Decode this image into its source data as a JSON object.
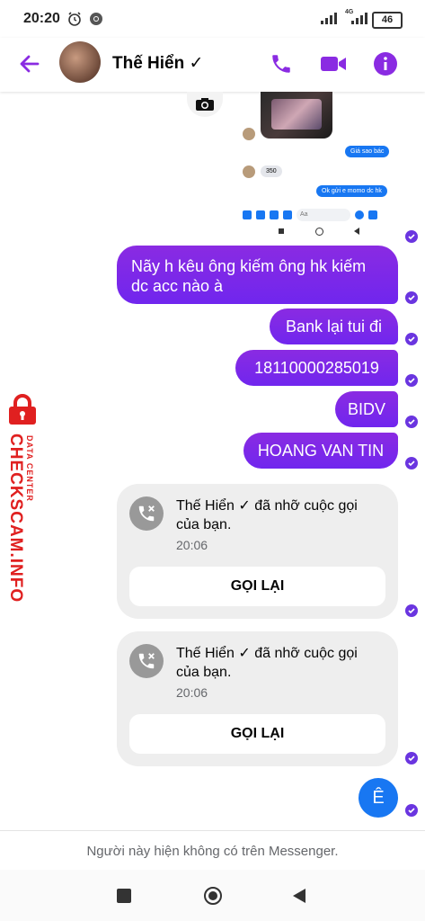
{
  "status_bar": {
    "time": "20:20",
    "battery": "46",
    "network": "4G"
  },
  "header": {
    "contact_name": "Thế Hiển ✓",
    "accent_color": "#8a2be2"
  },
  "embedded_screenshot": {
    "messages": [
      {
        "direction": "in",
        "text": "350"
      },
      {
        "direction": "out",
        "text": "Giá sao bác"
      },
      {
        "direction": "out",
        "text": "Ok gửi e momo dc hk"
      }
    ],
    "input_placeholder": "Aa"
  },
  "messages": [
    {
      "direction": "out",
      "text": "Nãy h kêu ông kiếm ông hk kiếm dc acc nào à"
    },
    {
      "direction": "out",
      "text": "Bank lại tui đi"
    },
    {
      "direction": "out",
      "text": "18110000285019"
    },
    {
      "direction": "out",
      "text": "BIDV"
    },
    {
      "direction": "out",
      "text": "HOANG VAN TIN"
    }
  ],
  "missed_calls": [
    {
      "text": "Thế Hiển ✓ đã nhỡ cuộc gọi của bạn.",
      "time": "20:06",
      "button": "GỌI LẠI"
    },
    {
      "text": "Thế Hiển ✓ đã nhỡ cuộc gọi của bạn.",
      "time": "20:06",
      "button": "GỌI LẠI"
    }
  ],
  "last_message": {
    "direction": "out",
    "text": "Ê"
  },
  "watermark": {
    "main": "CHECKSCAM.INFO",
    "sub": "DATA CENTER"
  },
  "footer_notice": "Người này hiện không có trên Messenger."
}
